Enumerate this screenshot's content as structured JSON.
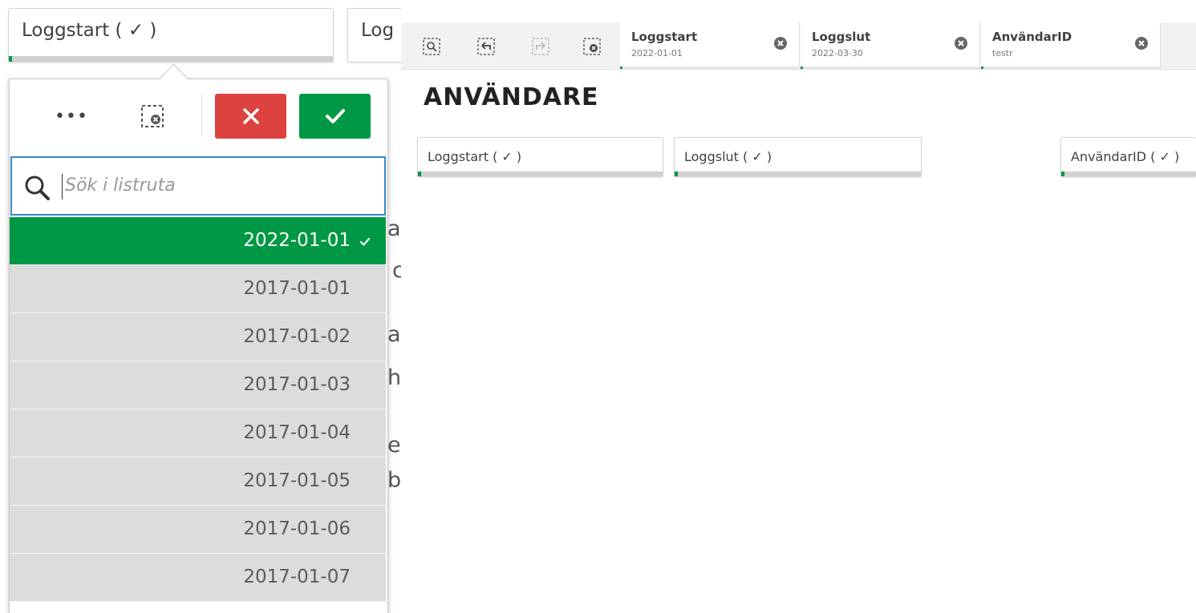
{
  "left_panel": {
    "filter_button_label": "Loggstart ( ✓ )",
    "filter_button2_label": "Log",
    "more_label": "•••",
    "search_placeholder": "Sök i listruta",
    "behind_text": [
      "at",
      "c",
      "al",
      "ha",
      "e",
      "b"
    ],
    "list": [
      {
        "value": "2022-01-01",
        "selected": true
      },
      {
        "value": "2017-01-01",
        "selected": false
      },
      {
        "value": "2017-01-02",
        "selected": false
      },
      {
        "value": "2017-01-03",
        "selected": false
      },
      {
        "value": "2017-01-04",
        "selected": false
      },
      {
        "value": "2017-01-05",
        "selected": false
      },
      {
        "value": "2017-01-06",
        "selected": false
      },
      {
        "value": "2017-01-07",
        "selected": false
      }
    ]
  },
  "selections_bar": {
    "tools": [
      "smart-search-icon",
      "step-back-icon",
      "step-forward-icon",
      "clear-all-icon"
    ],
    "chips": [
      {
        "title": "Loggstart",
        "value": "2022-01-01"
      },
      {
        "title": "Loggslut",
        "value": "2022-03-30"
      },
      {
        "title": "AnvändarID",
        "value": "testr"
      }
    ]
  },
  "sheet": {
    "heading": "ANVÄNDARE",
    "filters": [
      {
        "label": "Loggstart ( ✓ )"
      },
      {
        "label": "Loggslut ( ✓ )"
      },
      {
        "label": "AnvändarID ( ✓ )"
      }
    ]
  },
  "colors": {
    "accent_green": "#009845",
    "cancel_red": "#dc423f",
    "search_border": "#3c87c4"
  }
}
